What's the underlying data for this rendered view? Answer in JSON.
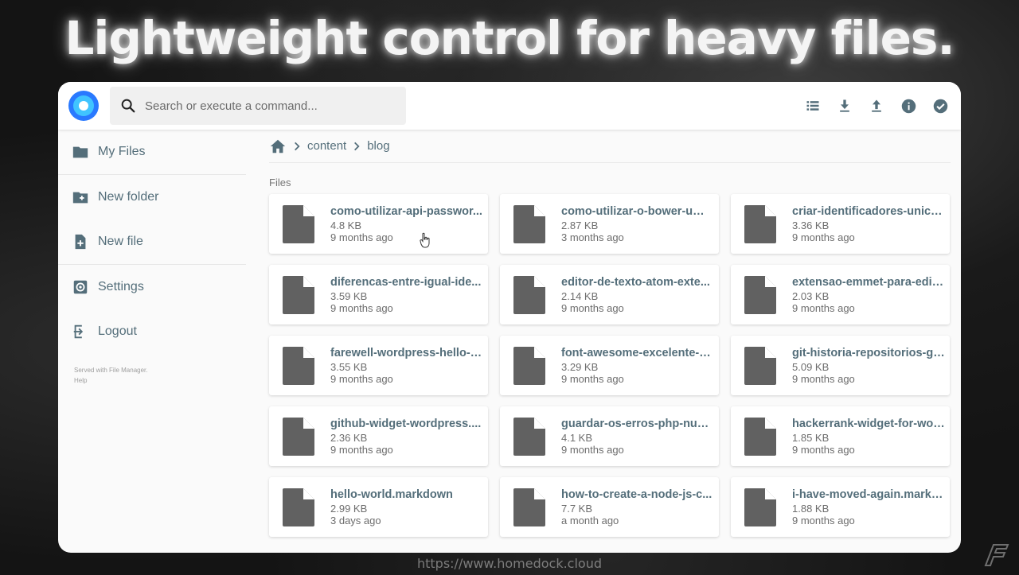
{
  "headline": "Lightweight control for heavy files.",
  "search": {
    "placeholder": "Search or execute a command..."
  },
  "toolbar": {
    "icons": [
      "list-view-icon",
      "download-icon",
      "upload-icon",
      "info-icon",
      "check-circle-icon"
    ]
  },
  "sidebar": {
    "items": [
      {
        "label": "My Files",
        "icon": "folder-icon"
      },
      {
        "label": "New folder",
        "icon": "create-folder-icon"
      },
      {
        "label": "New file",
        "icon": "note-add-icon"
      },
      {
        "label": "Settings",
        "icon": "settings-icon"
      },
      {
        "label": "Logout",
        "icon": "exit-icon"
      }
    ],
    "credits_line1": "Served with File Manager.",
    "credits_line2": "Help"
  },
  "breadcrumb": {
    "items": [
      "content",
      "blog"
    ]
  },
  "section_title": "Files",
  "files": [
    {
      "name": "como-utilizar-api-passwor...",
      "size": "4.8 KB",
      "modified": "9 months ago"
    },
    {
      "name": "como-utilizar-o-bower-um-...",
      "size": "2.87 KB",
      "modified": "3 months ago"
    },
    {
      "name": "criar-identificadores-unico...",
      "size": "3.36 KB",
      "modified": "9 months ago"
    },
    {
      "name": "diferencas-entre-igual-ide...",
      "size": "3.59 KB",
      "modified": "9 months ago"
    },
    {
      "name": "editor-de-texto-atom-exte...",
      "size": "2.14 KB",
      "modified": "9 months ago"
    },
    {
      "name": "extensao-emmet-para-edit...",
      "size": "2.03 KB",
      "modified": "9 months ago"
    },
    {
      "name": "farewell-wordpress-hello-h...",
      "size": "3.55 KB",
      "modified": "9 months ago"
    },
    {
      "name": "font-awesome-excelente-p...",
      "size": "3.29 KB",
      "modified": "9 months ago"
    },
    {
      "name": "git-historia-repositorios-gi...",
      "size": "5.09 KB",
      "modified": "9 months ago"
    },
    {
      "name": "github-widget-wordpress....",
      "size": "2.36 KB",
      "modified": "9 months ago"
    },
    {
      "name": "guardar-os-erros-php-num...",
      "size": "4.1 KB",
      "modified": "9 months ago"
    },
    {
      "name": "hackerrank-widget-for-wor...",
      "size": "1.85 KB",
      "modified": "9 months ago"
    },
    {
      "name": "hello-world.markdown",
      "size": "2.99 KB",
      "modified": "3 days ago"
    },
    {
      "name": "how-to-create-a-node-js-c...",
      "size": "7.7 KB",
      "modified": "a month ago"
    },
    {
      "name": "i-have-moved-again.markd...",
      "size": "1.88 KB",
      "modified": "9 months ago"
    }
  ],
  "footer_url": "https://www.homedock.cloud",
  "colors": {
    "accent": "#2979ff",
    "accent_light": "#40c4ff",
    "text": "#546e7a",
    "file_icon": "#616161"
  }
}
